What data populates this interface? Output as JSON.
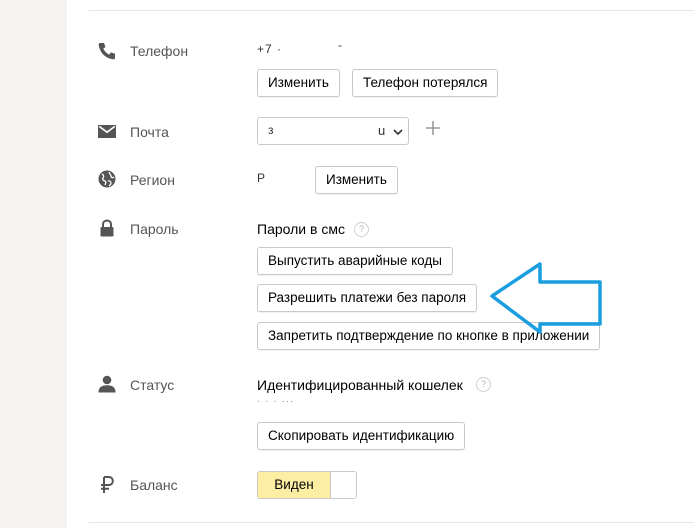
{
  "rows": {
    "phone": {
      "label": "Телефон",
      "value": "+7 ·",
      "value_tail": "-",
      "change_button": "Изменить",
      "lost_button": "Телефон потерялся"
    },
    "email": {
      "label": "Почта",
      "value_start": "з",
      "value_end": "u"
    },
    "region": {
      "label": "Регион",
      "value": "Р",
      "change_button": "Изменить"
    },
    "password": {
      "label": "Пароль",
      "mode": "Пароли в смс",
      "help": "?",
      "emergency_codes_button": "Выпустить аварийные коды",
      "allow_payments_button": "Разрешить платежи без пароля",
      "forbid_confirm_button": "Запретить подтверждение по кнопке в приложении"
    },
    "status": {
      "label": "Статус",
      "value": "Идентифицированный кошелек",
      "help": "?",
      "masked_line": "·                    ·  ·  ···",
      "copy_button": "Скопировать идентификацию"
    },
    "balance": {
      "label": "Баланс",
      "toggle_label": "Виден"
    }
  },
  "colors": {
    "arrow": "#1a9ee0",
    "toggle_on": "#fdeea3",
    "sidebar": "#f4f3f1"
  }
}
